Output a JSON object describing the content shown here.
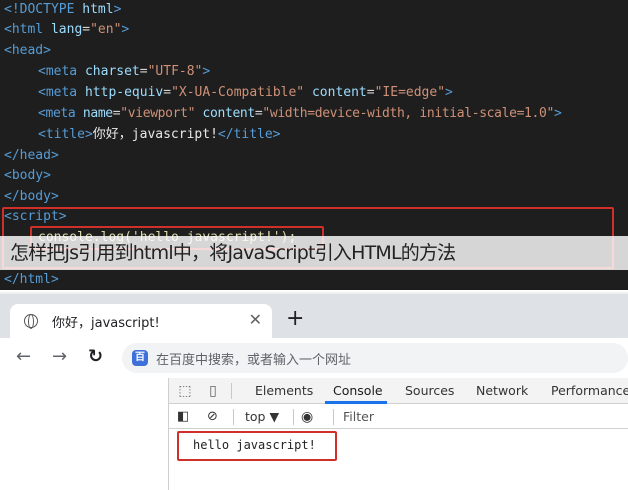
{
  "code": {
    "doctype": "<!DOCTYPE",
    "doctype_html": "html",
    "doctype_close": ">",
    "html_open": "<html",
    "lang_attr": "lang",
    "lang_value": "\"en\"",
    "tag_close": ">",
    "head_open": "<head>",
    "meta1_tag": "<meta",
    "meta1_attr": "charset",
    "meta1_value": "\"UTF-8\"",
    "meta2_tag": "<meta",
    "meta2_attr1": "http-equiv",
    "meta2_value1": "\"X-UA-Compatible\"",
    "meta2_attr2": "content",
    "meta2_value2": "\"IE=edge\"",
    "meta3_tag": "<meta",
    "meta3_attr1": "name",
    "meta3_value1": "\"viewport\"",
    "meta3_attr2": "content",
    "meta3_value2": "\"width=device-width, initial-scale=1.0\"",
    "title_open": "<title>",
    "title_text": "你好，javascript!",
    "title_close": "</title>",
    "head_close": "</head>",
    "body_open": "<body>",
    "body_close": "</body>",
    "script_open": "<script>",
    "script_line": "console.log('hello javascript!');",
    "html_close": "</html>"
  },
  "overlay_title": "怎样把js引用到html中，将JavaScript引入HTML的方法",
  "browser": {
    "tab_title": "你好，javascript!",
    "tab_close": "✕",
    "new_tab": "+",
    "back": "←",
    "forward": "→",
    "reload": "↻",
    "omnibox_icon": "百",
    "omnibox_placeholder": "在百度中搜索，或者输入一个网址"
  },
  "devtools": {
    "tabs": [
      "Elements",
      "Console",
      "Sources",
      "Network",
      "Performance"
    ],
    "active_tab": "Console",
    "context": "top ▼",
    "filter": "Filter",
    "log_output": "hello javascript!"
  },
  "colors": {
    "editor_bg": "#1e1e1e",
    "tag": "#569cd6",
    "attribute": "#9cdcfe",
    "string": "#ce9178",
    "highlight": "#d0302a",
    "accent": "#1a73e8"
  }
}
